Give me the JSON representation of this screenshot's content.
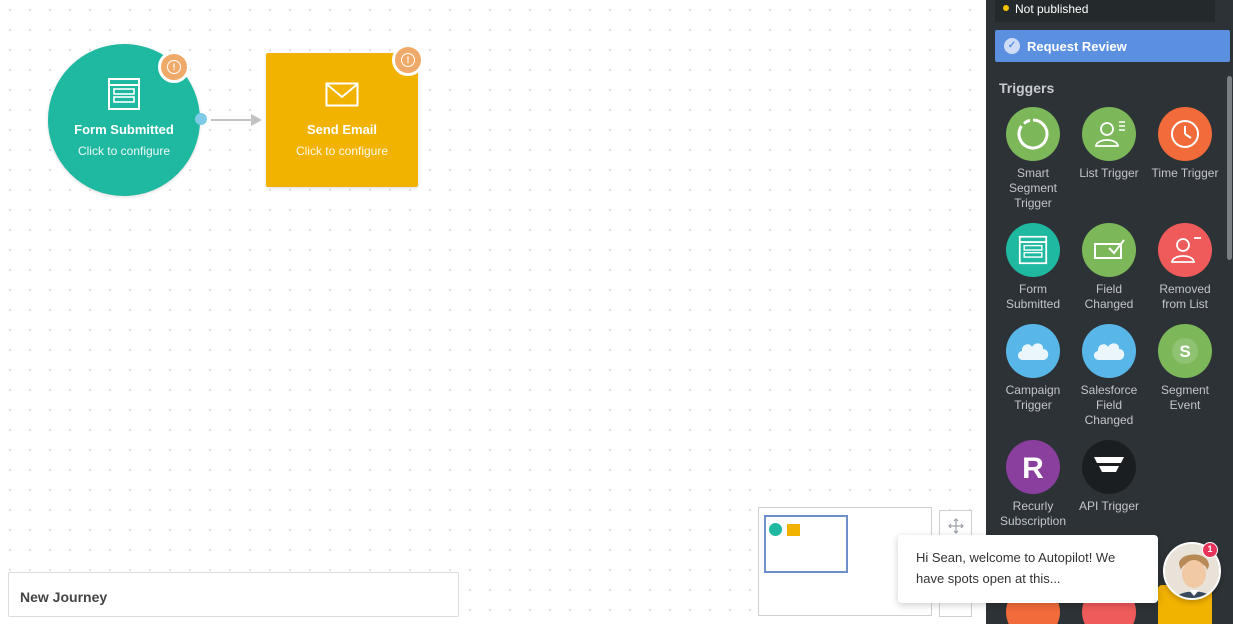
{
  "canvas": {
    "nodes": [
      {
        "title": "Form Submitted",
        "subtitle": "Click to configure",
        "icon": "form-icon",
        "color": "#1fb8a0"
      },
      {
        "title": "Send Email",
        "subtitle": "Click to configure",
        "icon": "envelope-icon",
        "color": "#f2b200"
      }
    ],
    "warning_glyph": "!",
    "journey_name": "New Journey"
  },
  "sidebar": {
    "status": "Not published",
    "review_button": "Request Review",
    "triggers_title": "Triggers",
    "triggers": [
      {
        "label": "Smart Segment Trigger",
        "icon": "smart-segment-icon",
        "color": "#7cb85a"
      },
      {
        "label": "List Trigger",
        "icon": "list-user-icon",
        "color": "#7cb85a"
      },
      {
        "label": "Time Trigger",
        "icon": "clock-icon",
        "color": "#f26b3a"
      },
      {
        "label": "Form Submitted",
        "icon": "form-icon",
        "color": "#1fb8a0"
      },
      {
        "label": "Field Changed",
        "icon": "field-check-icon",
        "color": "#7cb85a"
      },
      {
        "label": "Removed from List",
        "icon": "user-remove-icon",
        "color": "#ef5b5b"
      },
      {
        "label": "Campaign Trigger",
        "icon": "salesforce-cloud-icon",
        "color": "#58b7e8"
      },
      {
        "label": "Salesforce Field Changed",
        "icon": "salesforce-cloud-icon",
        "color": "#58b7e8"
      },
      {
        "label": "Segment Event",
        "icon": "segment-s-icon",
        "color": "#7cb85a"
      },
      {
        "label": "Recurly Subscription",
        "icon": "recurly-r-icon",
        "color": "#8a3f9e"
      },
      {
        "label": "API Trigger",
        "icon": "api-funnel-icon",
        "color": "#1b1e20"
      }
    ]
  },
  "chat": {
    "message": "Hi Sean, welcome to Autopilot! We have spots open at this...",
    "unread_count": "1"
  }
}
